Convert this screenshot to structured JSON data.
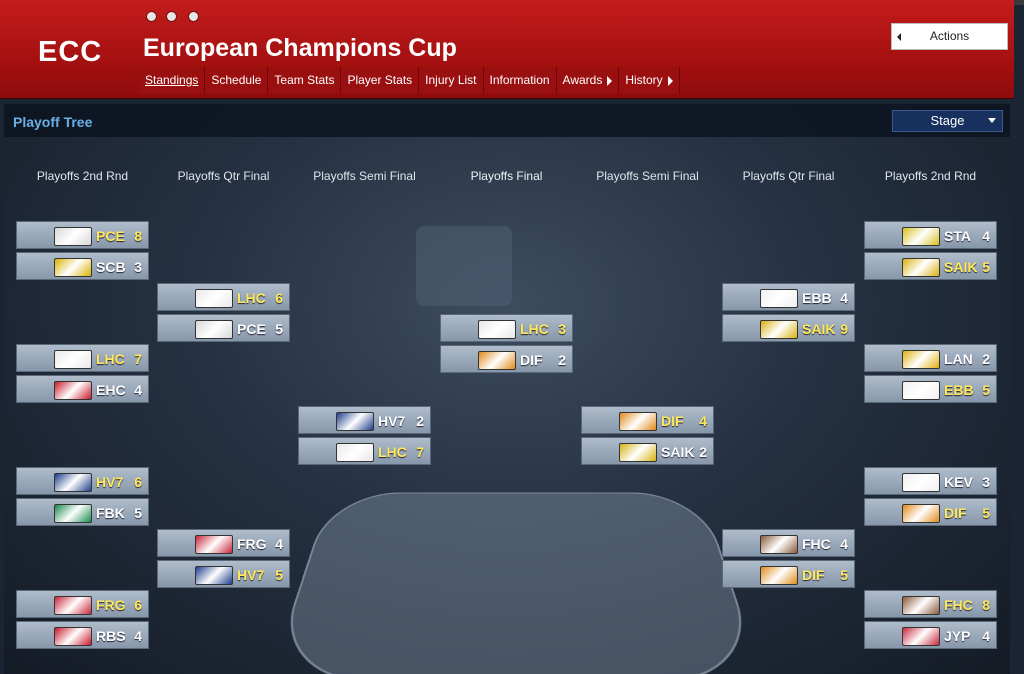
{
  "header": {
    "abbr": "ECC",
    "title": "European Champions Cup",
    "actions_label": "Actions",
    "tabs": [
      {
        "label": "Standings",
        "active": true
      },
      {
        "label": "Schedule"
      },
      {
        "label": "Team Stats"
      },
      {
        "label": "Player Stats"
      },
      {
        "label": "Injury List"
      },
      {
        "label": "Information"
      },
      {
        "label": "Awards",
        "submenu": true
      },
      {
        "label": "History",
        "submenu": true
      }
    ]
  },
  "panel": {
    "title": "Playoff Tree",
    "stage_select": "Stage"
  },
  "rounds": [
    "Playoffs 2nd Rnd",
    "Playoffs Qtr Final",
    "Playoffs Semi Final",
    "Playoffs Final",
    "Playoffs Semi Final",
    "Playoffs Qtr Final",
    "Playoffs 2nd Rnd"
  ],
  "matchups": [
    {
      "round": 0,
      "teams": [
        {
          "abbr": "PCE",
          "score": "8",
          "winner": true,
          "logo": "pce-logo"
        },
        {
          "abbr": "SCB",
          "score": "3",
          "logo": "scb-logo"
        }
      ]
    },
    {
      "round": 0,
      "teams": [
        {
          "abbr": "LHC",
          "score": "7",
          "winner": true,
          "logo": "lhc-logo"
        },
        {
          "abbr": "EHC",
          "score": "4",
          "logo": "ehc-logo"
        }
      ]
    },
    {
      "round": 0,
      "teams": [
        {
          "abbr": "HV7",
          "score": "6",
          "winner": true,
          "logo": "hv7-logo"
        },
        {
          "abbr": "FBK",
          "score": "5",
          "logo": "fbk-logo"
        }
      ]
    },
    {
      "round": 0,
      "teams": [
        {
          "abbr": "FRG",
          "score": "6",
          "winner": true,
          "logo": "frg-logo"
        },
        {
          "abbr": "RBS",
          "score": "4",
          "logo": "rbs-logo"
        }
      ]
    },
    {
      "round": 1,
      "teams": [
        {
          "abbr": "LHC",
          "score": "6",
          "winner": true,
          "logo": "lhc-logo"
        },
        {
          "abbr": "PCE",
          "score": "5",
          "logo": "pce-logo"
        }
      ]
    },
    {
      "round": 1,
      "teams": [
        {
          "abbr": "FRG",
          "score": "4",
          "logo": "frg-logo"
        },
        {
          "abbr": "HV7",
          "score": "5",
          "winner": true,
          "logo": "hv7-logo"
        }
      ]
    },
    {
      "round": 2,
      "teams": [
        {
          "abbr": "HV7",
          "score": "2",
          "logo": "hv7-logo"
        },
        {
          "abbr": "LHC",
          "score": "7",
          "winner": true,
          "logo": "lhc-logo"
        }
      ]
    },
    {
      "round": 3,
      "teams": [
        {
          "abbr": "LHC",
          "score": "3",
          "winner": true,
          "logo": "lhc-logo"
        },
        {
          "abbr": "DIF",
          "score": "2",
          "logo": "dif-logo"
        }
      ]
    },
    {
      "round": 4,
      "teams": [
        {
          "abbr": "DIF",
          "score": "4",
          "winner": true,
          "logo": "dif-logo"
        },
        {
          "abbr": "SAIK",
          "score": "2",
          "logo": "saik-logo"
        }
      ]
    },
    {
      "round": 5,
      "teams": [
        {
          "abbr": "EBB",
          "score": "4",
          "logo": "ebb-logo"
        },
        {
          "abbr": "SAIK",
          "score": "9",
          "winner": true,
          "logo": "saik-logo"
        }
      ]
    },
    {
      "round": 5,
      "teams": [
        {
          "abbr": "FHC",
          "score": "4",
          "logo": "fhc-logo"
        },
        {
          "abbr": "DIF",
          "score": "5",
          "winner": true,
          "logo": "dif-logo"
        }
      ]
    },
    {
      "round": 6,
      "teams": [
        {
          "abbr": "STA",
          "score": "4",
          "logo": "sta-logo"
        },
        {
          "abbr": "SAIK",
          "score": "5",
          "winner": true,
          "logo": "saik-logo"
        }
      ]
    },
    {
      "round": 6,
      "teams": [
        {
          "abbr": "LAN",
          "score": "2",
          "logo": "lan-logo"
        },
        {
          "abbr": "EBB",
          "score": "5",
          "winner": true,
          "logo": "ebb-logo"
        }
      ]
    },
    {
      "round": 6,
      "teams": [
        {
          "abbr": "KEV",
          "score": "3",
          "logo": "kev-logo"
        },
        {
          "abbr": "DIF",
          "score": "5",
          "winner": true,
          "logo": "dif-logo"
        }
      ]
    },
    {
      "round": 6,
      "teams": [
        {
          "abbr": "FHC",
          "score": "8",
          "winner": true,
          "logo": "fhc-logo"
        },
        {
          "abbr": "JYP",
          "score": "4",
          "logo": "jyp-logo"
        }
      ]
    }
  ],
  "colors": {
    "header_red": "#b31616",
    "winner_text": "#ffe95a",
    "panel_title": "#6ab0e6",
    "card_bg": "#9aa9ba"
  },
  "logo_colors": {
    "pce-logo": "#d8d8d8",
    "scb-logo": "#d8b200",
    "lhc-logo": "#e8e8e8",
    "ehc-logo": "#c81c2c",
    "hv7-logo": "#1c3e8c",
    "fbk-logo": "#1a8a4a",
    "frg-logo": "#c8283c",
    "rbs-logo": "#c8182c",
    "dif-logo": "#e08a18",
    "saik-logo": "#d8b010",
    "ebb-logo": "#f0f0f0",
    "fhc-logo": "#8a5a3a",
    "sta-logo": "#d8c020",
    "lan-logo": "#e0b010",
    "kev-logo": "#f0f0f0",
    "jyp-logo": "#c8283c"
  }
}
